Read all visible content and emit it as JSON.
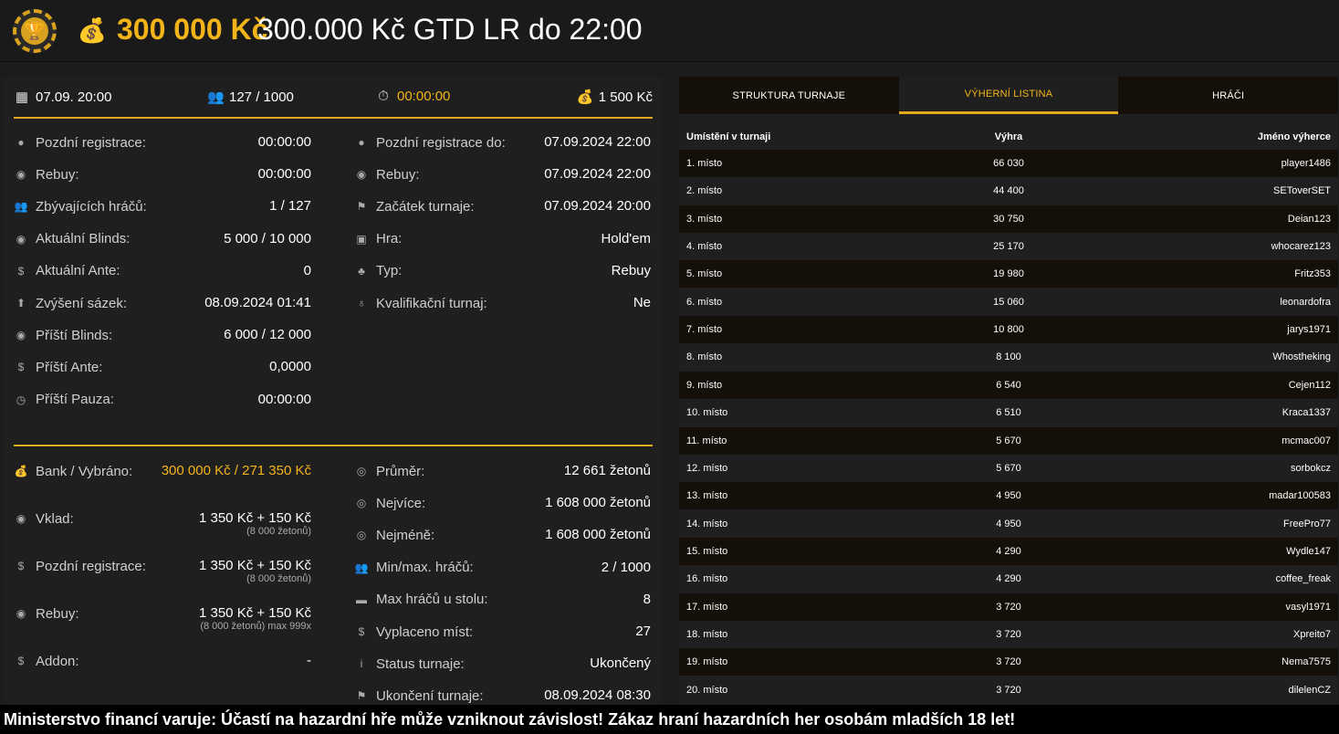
{
  "header": {
    "amount": "300 000 Kč",
    "name": "300.000 Kč GTD LR do 22:00"
  },
  "topstats": {
    "date": "07.09. 20:00",
    "players": "127 / 1000",
    "timer": "00:00:00",
    "buyin": "1 500 Kč"
  },
  "left1": [
    {
      "label": "Pozdní registrace:",
      "value": "00:00:00",
      "icon": "user-icon"
    },
    {
      "label": "Rebuy:",
      "value": "00:00:00",
      "icon": "chips-icon"
    },
    {
      "label": "Zbývajících hráčů:",
      "value": "1 / 127",
      "icon": "users-icon"
    },
    {
      "label": "Aktuální Blinds:",
      "value": "5 000 / 10 000",
      "icon": "chips-icon"
    },
    {
      "label": "Aktuální Ante:",
      "value": "0",
      "icon": "coin-icon"
    },
    {
      "label": "Zvýšení sázek:",
      "value": "08.09.2024 01:41",
      "icon": "arrow-up-icon"
    },
    {
      "label": "Příští Blinds:",
      "value": "6 000 / 12 000",
      "icon": "chips-icon"
    },
    {
      "label": "Příští Ante:",
      "value": "0,0000",
      "icon": "coin-icon"
    },
    {
      "label": "Příští Pauza:",
      "value": "00:00:00",
      "icon": "clock-icon"
    }
  ],
  "right1": [
    {
      "label": "Pozdní registrace do:",
      "value": "07.09.2024 22:00",
      "icon": "user-icon"
    },
    {
      "label": "Rebuy:",
      "value": "07.09.2024 22:00",
      "icon": "chips-icon"
    },
    {
      "label": "Začátek turnaje:",
      "value": "07.09.2024 20:00",
      "icon": "flag-icon"
    },
    {
      "label": "Hra:",
      "value": "Hold'em",
      "icon": "cards-icon"
    },
    {
      "label": "Typ:",
      "value": "Rebuy",
      "icon": "suits-icon"
    },
    {
      "label": "Kvalifikační turnaj:",
      "value": "Ne",
      "icon": "medal-icon"
    }
  ],
  "left2": [
    {
      "label": "Bank / Vybráno:",
      "value": "300 000 Kč / 271 350 Kč",
      "sub": "",
      "icon": "bag-icon"
    },
    {
      "label": "Vklad:",
      "value": "1 350 Kč + 150 Kč",
      "sub": "(8 000 žetonů)",
      "icon": "chips-icon"
    },
    {
      "label": "Pozdní registrace:",
      "value": "1 350 Kč + 150 Kč",
      "sub": "(8 000 žetonů)",
      "icon": "coin-icon"
    },
    {
      "label": "Rebuy:",
      "value": "1 350 Kč + 150 Kč",
      "sub": "(8 000 žetonů) max 999x",
      "icon": "chips-icon"
    },
    {
      "label": "Addon:",
      "value": "-",
      "sub": "",
      "icon": "coin-icon"
    }
  ],
  "right2": [
    {
      "label": "Průměr:",
      "value": "12 661 žetonů",
      "icon": "chip-icon"
    },
    {
      "label": "Nejvíce:",
      "value": "1 608 000 žetonů",
      "icon": "chip-icon"
    },
    {
      "label": "Nejméně:",
      "value": "1 608 000 žetonů",
      "icon": "chip-icon"
    },
    {
      "label": "Min/max. hráčů:",
      "value": "2 / 1000",
      "icon": "users-icon"
    },
    {
      "label": "Max hráčů u stolu:",
      "value": "8",
      "icon": "table-icon"
    },
    {
      "label": "Vyplaceno míst:",
      "value": "27",
      "icon": "money-icon"
    },
    {
      "label": "Status turnaje:",
      "value": "Ukončený",
      "icon": "info-icon"
    },
    {
      "label": "Ukončení turnaje:",
      "value": "08.09.2024 08:30",
      "icon": "flag-icon"
    }
  ],
  "tabs": [
    "STRUKTURA TURNAJE",
    "VÝHERNÍ LISTINA",
    "HRÁČI"
  ],
  "table": {
    "headers": [
      "Umístění v turnaji",
      "Výhra",
      "Jméno výherce"
    ],
    "rows": [
      [
        "1. místo",
        "66 030",
        "player1486"
      ],
      [
        "2. místo",
        "44 400",
        "SEToverSET"
      ],
      [
        "3. místo",
        "30 750",
        "Deian123"
      ],
      [
        "4. místo",
        "25 170",
        "whocarez123"
      ],
      [
        "5. místo",
        "19 980",
        "Fritz353"
      ],
      [
        "6. místo",
        "15 060",
        "leonardofra"
      ],
      [
        "7. místo",
        "10 800",
        "jarys1971"
      ],
      [
        "8. místo",
        "8 100",
        "Whostheking"
      ],
      [
        "9. místo",
        "6 540",
        "Cejen112"
      ],
      [
        "10. místo",
        "6 510",
        "Kraca1337"
      ],
      [
        "11. místo",
        "5 670",
        "mcmac007"
      ],
      [
        "12. místo",
        "5 670",
        "sorbokcz"
      ],
      [
        "13. místo",
        "4 950",
        "madar100583"
      ],
      [
        "14. místo",
        "4 950",
        "FreePro77"
      ],
      [
        "15. místo",
        "4 290",
        "Wydle147"
      ],
      [
        "16. místo",
        "4 290",
        "coffee_freak"
      ],
      [
        "17. místo",
        "3 720",
        "vasyl1971"
      ],
      [
        "18. místo",
        "3 720",
        "Xpreito7"
      ],
      [
        "19. místo",
        "3 720",
        "Nema7575"
      ],
      [
        "20. místo",
        "3 720",
        "dilelenCZ"
      ]
    ]
  },
  "footer": "Ministerstvo financí varuje: Účastí na hazardní hře může vzniknout závislost! Zákaz hraní hazardních her osobám mladších 18 let!"
}
